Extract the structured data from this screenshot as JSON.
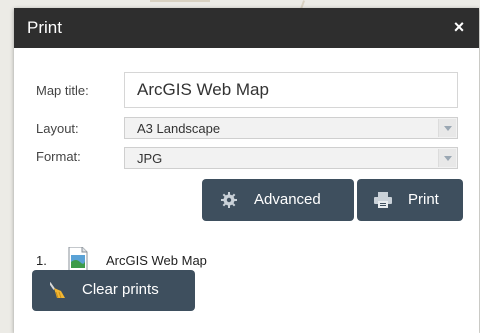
{
  "dialog": {
    "title": "Print",
    "close_label": "×"
  },
  "form": {
    "map_title_label": "Map title:",
    "map_title_value": "ArcGIS Web Map",
    "layout_label": "Layout:",
    "layout_value": "A3 Landscape",
    "format_label": "Format:",
    "format_value": "JPG"
  },
  "buttons": {
    "advanced_label": "Advanced",
    "print_label": "Print",
    "clear_label": "Clear prints"
  },
  "results": [
    {
      "number": "1.",
      "name": "ArcGIS Web Map"
    }
  ],
  "colors": {
    "titlebar": "#2e2e2e",
    "button": "#3e4f5e",
    "clear_icon_bristles": "#f2b632"
  },
  "icons": {
    "advanced": "gear-icon",
    "print": "printer-icon",
    "clear": "broom-icon",
    "result": "image-file-icon"
  }
}
